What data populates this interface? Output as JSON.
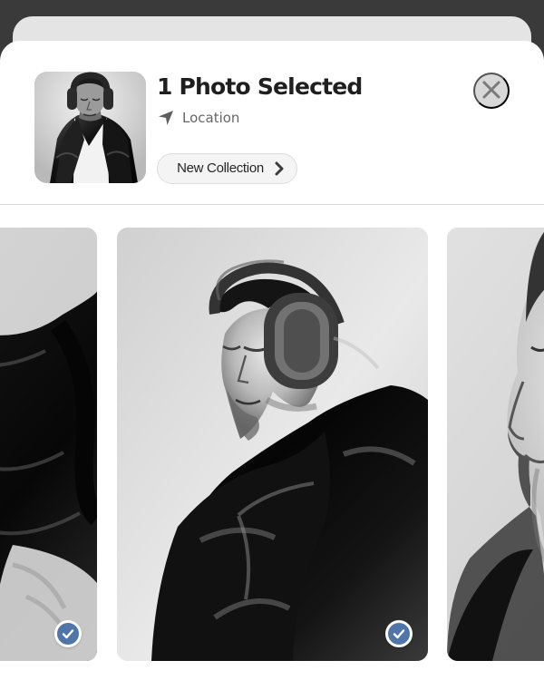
{
  "selection": {
    "title": "1 Photo Selected",
    "location": "Location",
    "collection_button": "New Collection"
  },
  "icons": {
    "thumbnail": "person-photo",
    "location": "location-arrow-icon",
    "collection": "chevron-right-icon",
    "close": "close-icon",
    "selected": "check-icon"
  },
  "gallery": {
    "photos": [
      {
        "kind": "partial-left",
        "selected": true
      },
      {
        "kind": "center",
        "selected": true
      },
      {
        "kind": "partial-right",
        "selected": false
      }
    ]
  },
  "colors": {
    "background": "#3a3a3a",
    "sheet": "#ffffff",
    "selection": "#5075a9",
    "close_button": "#d8d8d8"
  }
}
